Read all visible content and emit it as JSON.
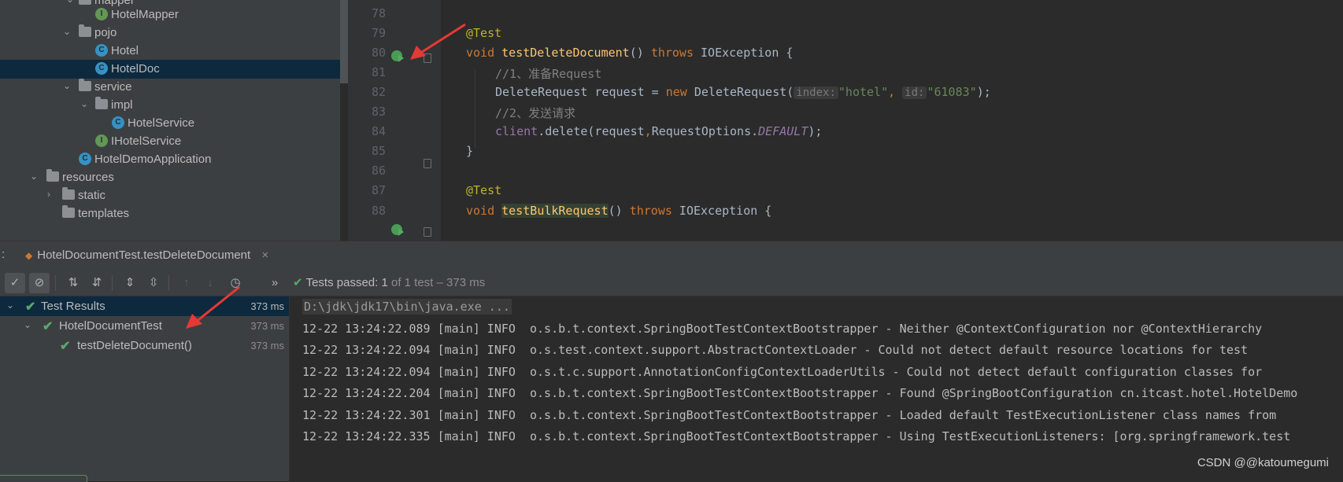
{
  "project_tree": {
    "items": [
      {
        "label": "mapper",
        "kind": "package",
        "indent": 2,
        "expanded": true
      },
      {
        "label": "HotelMapper",
        "kind": "interface",
        "indent": 3
      },
      {
        "label": "pojo",
        "kind": "package",
        "indent": 2,
        "expanded": true
      },
      {
        "label": "Hotel",
        "kind": "class",
        "indent": 3
      },
      {
        "label": "HotelDoc",
        "kind": "class",
        "indent": 3,
        "selected": true
      },
      {
        "label": "service",
        "kind": "package",
        "indent": 2,
        "expanded": true
      },
      {
        "label": "impl",
        "kind": "package",
        "indent": 3,
        "expanded": true
      },
      {
        "label": "HotelService",
        "kind": "class",
        "indent": 4
      },
      {
        "label": "IHotelService",
        "kind": "interface",
        "indent": 3
      },
      {
        "label": "HotelDemoApplication",
        "kind": "class",
        "indent": 2
      },
      {
        "label": "resources",
        "kind": "folder",
        "indent": 1,
        "expanded": true
      },
      {
        "label": "static",
        "kind": "folder",
        "indent": 2,
        "expanded": false
      },
      {
        "label": "templates",
        "kind": "folder",
        "indent": 2
      }
    ]
  },
  "editor": {
    "line_numbers": [
      "78",
      "79",
      "80",
      "81",
      "82",
      "83",
      "84",
      "85",
      "86",
      "87",
      "88"
    ],
    "code": {
      "l79_annotation": "@Test",
      "l80_void": "void",
      "l80_method": "testDeleteDocument",
      "l80_paren": "() ",
      "l80_throws": "throws",
      "l80_exc": " IOException {",
      "l81_comment": "//1、准备Request",
      "l82_a": "DeleteRequest request = ",
      "l82_new": "new",
      "l82_b": " DeleteRequest(",
      "l82_hint_index": "index:",
      "l82_str_index": "\"hotel\"",
      "l82_comma": ", ",
      "l82_hint_id": "id:",
      "l82_str_id": "\"61083\"",
      "l82_end": ");",
      "l83_comment": "//2、发送请求",
      "l84_client": "client",
      "l84_a": ".delete(request",
      "l84_comma": ",",
      "l84_b": "RequestOptions.",
      "l84_const": "DEFAULT",
      "l84_end": ");",
      "l85_brace": "}",
      "l87_annotation": "@Test",
      "l88_void": "void",
      "l88_method_a": "testB",
      "l88_method_b": "ulkRequest",
      "l88_paren": "() ",
      "l88_throws": "throws",
      "l88_exc": " IOException {"
    }
  },
  "run_tab": {
    "prefix": ":",
    "label": "HotelDocumentTest.testDeleteDocument",
    "close": "×"
  },
  "toolbar": {
    "overflow": "»",
    "status_passed": "Tests passed: ",
    "status_count": "1",
    "status_suffix": " of 1 test – 373 ms"
  },
  "test_results": [
    {
      "label": "Test Results",
      "time": "373 ms",
      "level": 0,
      "selected": true
    },
    {
      "label": "HotelDocumentTest",
      "time": "373 ms",
      "level": 1
    },
    {
      "label": "testDeleteDocument()",
      "time": "373 ms",
      "level": 2
    }
  ],
  "console": {
    "command": "D:\\jdk\\jdk17\\bin\\java.exe ...",
    "lines": [
      "12-22 13:24:22.089 [main] INFO  o.s.b.t.context.SpringBootTestContextBootstrapper - Neither @ContextConfiguration nor @ContextHierarchy",
      "12-22 13:24:22.094 [main] INFO  o.s.test.context.support.AbstractContextLoader - Could not detect default resource locations for test",
      "12-22 13:24:22.094 [main] INFO  o.s.t.c.support.AnnotationConfigContextLoaderUtils - Could not detect default configuration classes for",
      "12-22 13:24:22.204 [main] INFO  o.s.b.t.context.SpringBootTestContextBootstrapper - Found @SpringBootConfiguration cn.itcast.hotel.HotelDemo",
      "12-22 13:24:22.301 [main] INFO  o.s.b.t.context.SpringBootTestContextBootstrapper - Loaded default TestExecutionListener class names from",
      "12-22 13:24:22.335 [main] INFO  o.s.b.t.context.SpringBootTestContextBootstrapper - Using TestExecutionListeners: [org.springframework.test"
    ]
  },
  "watermark": "CSDN @@katoumegumi",
  "colors": {
    "pass_green": "#59a869",
    "arrow_red": "#e53935",
    "selection": "#0d293e"
  }
}
